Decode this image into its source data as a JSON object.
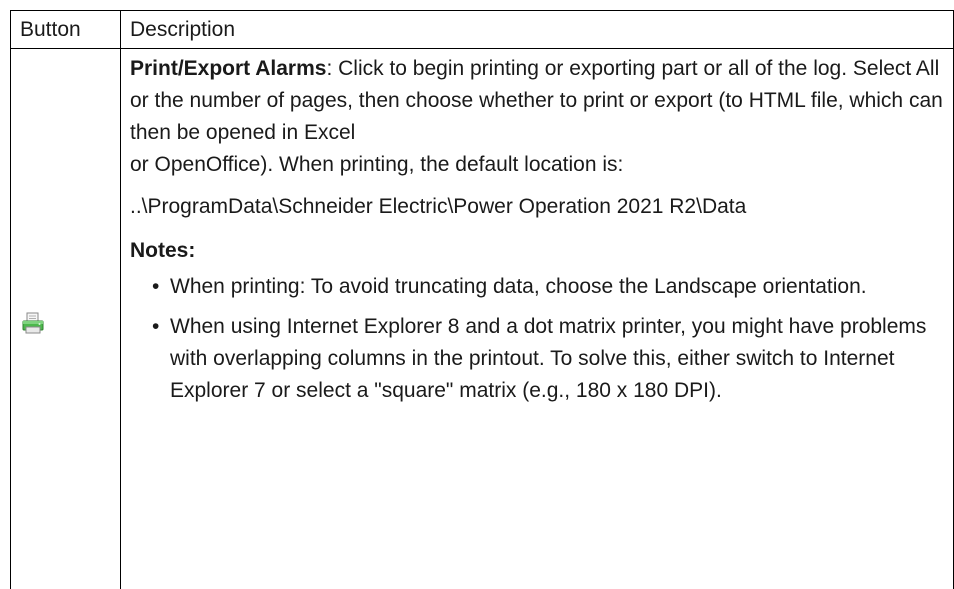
{
  "table": {
    "headers": [
      "Button",
      "Description"
    ],
    "row": {
      "icon": "printer-icon",
      "title": "Print/Export Alarms",
      "intro_rest": ": Click to begin printing or exporting part or all of the log. Select All or the number of pages, then choose whether to print or export (to HTML file, which can then be opened in Excel",
      "intro_line2": "or OpenOffice). When printing, the default location is:",
      "path": "..\\ProgramData\\Schneider Electric\\Power Operation 2021 R2\\Data",
      "notes_heading": "Notes:",
      "bullet_char": "•",
      "notes": [
        "When printing: To avoid truncating data, choose the Landscape orientation.",
        "When using Internet Explorer 8 and a dot matrix printer, you might have problems with overlapping columns in the printout. To solve this, either switch to Internet Explorer 7 or select a \"square\" matrix (e.g., 180 x 180 DPI)."
      ]
    }
  },
  "colors": {
    "border": "#000000",
    "text": "#1a1a1a",
    "icon_green": "#3aa53a"
  }
}
